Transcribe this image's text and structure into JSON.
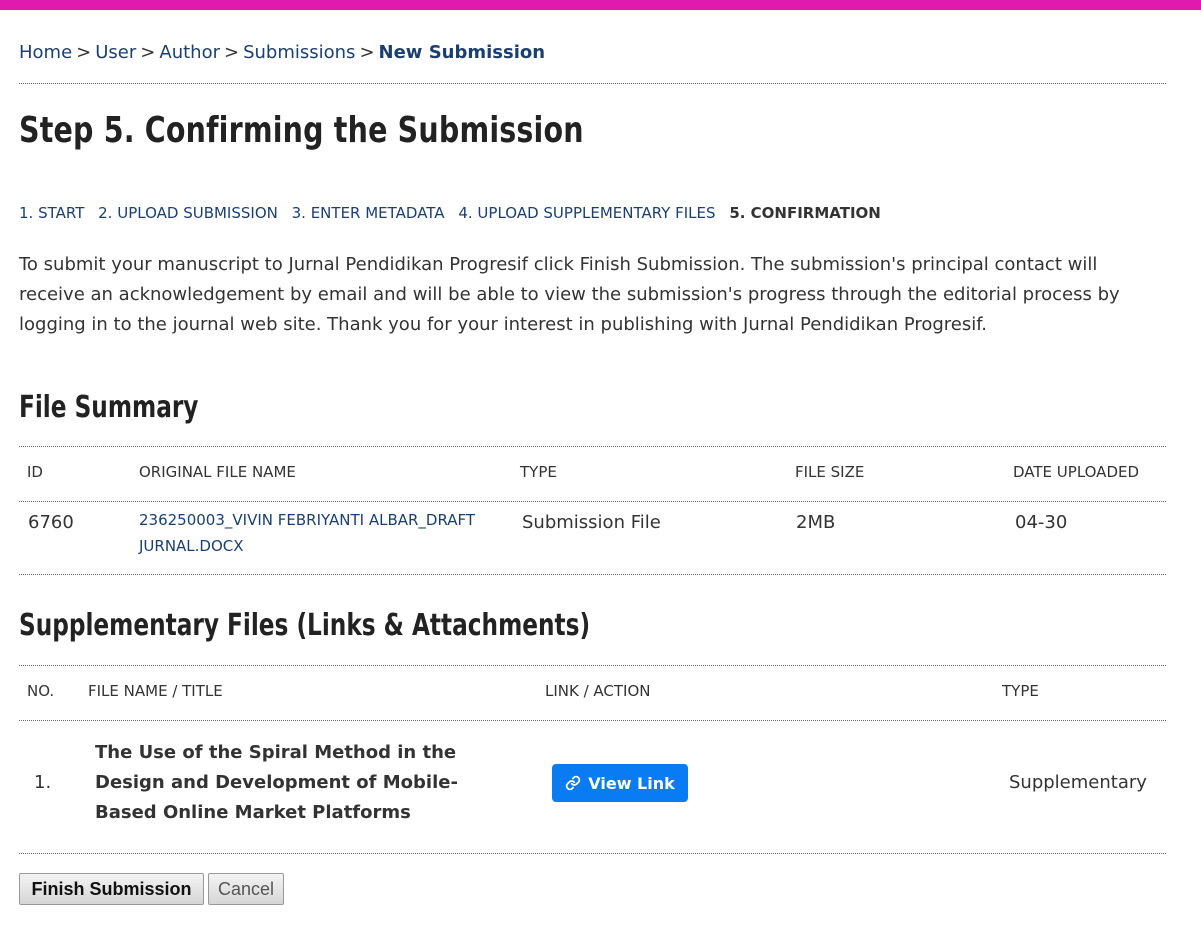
{
  "breadcrumb": {
    "items": [
      "Home",
      "User",
      "Author",
      "Submissions"
    ],
    "separator": ">",
    "current": "New Submission"
  },
  "page_title": "Step 5. Confirming the Submission",
  "steps": [
    "1. START",
    "2. UPLOAD SUBMISSION",
    "3. ENTER METADATA",
    "4. UPLOAD SUPPLEMENTARY FILES",
    "5. CONFIRMATION"
  ],
  "intro_text": "To submit your manuscript to Jurnal Pendidikan Progresif click Finish Submission. The submission's principal contact will receive an acknowledgement by email and will be able to view the submission's progress through the editorial process by logging in to the journal web site. Thank you for your interest in publishing with Jurnal Pendidikan Progresif.",
  "file_summary": {
    "title": "File Summary",
    "headers": [
      "ID",
      "ORIGINAL FILE NAME",
      "TYPE",
      "FILE SIZE",
      "DATE UPLOADED"
    ],
    "row": {
      "id": "6760",
      "file_name": "236250003_VIVIN FEBRIYANTI ALBAR_DRAFT JURNAL.DOCX",
      "type": "Submission File",
      "size": "2MB",
      "date": "04-30"
    }
  },
  "supplementary": {
    "title": "Supplementary Files (Links & Attachments)",
    "headers": [
      "NO.",
      "FILE NAME / TITLE",
      "LINK / ACTION",
      "TYPE"
    ],
    "row": {
      "no": "1.",
      "title": "The Use of the Spiral Method in the Design and Development of Mobile-Based Online Market Platforms",
      "action_label": "View Link",
      "type": "Supplementary"
    }
  },
  "buttons": {
    "finish": "Finish Submission",
    "cancel": "Cancel"
  },
  "colors": {
    "topbar": "#e01aae",
    "link": "#1b3f70",
    "button_primary": "#0a7cf3"
  },
  "icons": {
    "view_link": "link-icon"
  }
}
